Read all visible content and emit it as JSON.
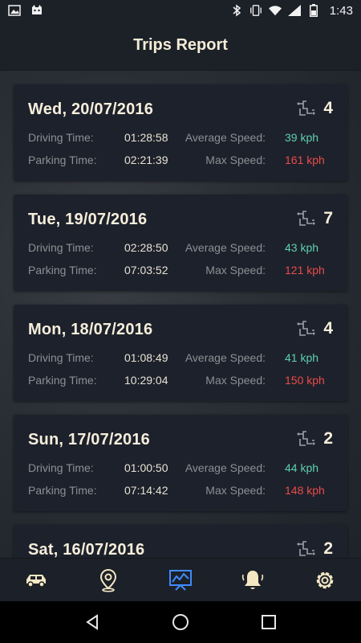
{
  "status_bar": {
    "time": "1:43"
  },
  "header": {
    "title": "Trips Report"
  },
  "labels": {
    "driving_time": "Driving Time:",
    "parking_time": "Parking Time:",
    "average_speed": "Average Speed:",
    "max_speed": "Max Speed:"
  },
  "reports": [
    {
      "date": "Wed, 20/07/2016",
      "trips": "4",
      "driving_time": "01:28:58",
      "parking_time": "02:21:39",
      "avg_speed": "39 kph",
      "max_speed": "161 kph"
    },
    {
      "date": "Tue, 19/07/2016",
      "trips": "7",
      "driving_time": "02:28:50",
      "parking_time": "07:03:52",
      "avg_speed": "43 kph",
      "max_speed": "121 kph"
    },
    {
      "date": "Mon, 18/07/2016",
      "trips": "4",
      "driving_time": "01:08:49",
      "parking_time": "10:29:04",
      "avg_speed": "41 kph",
      "max_speed": "150 kph"
    },
    {
      "date": "Sun, 17/07/2016",
      "trips": "2",
      "driving_time": "01:00:50",
      "parking_time": "07:14:42",
      "avg_speed": "44 kph",
      "max_speed": "148 kph"
    },
    {
      "date": "Sat, 16/07/2016",
      "trips": "2"
    }
  ],
  "bottom_nav": {
    "items": [
      {
        "icon": "car-icon"
      },
      {
        "icon": "location-pin-icon"
      },
      {
        "icon": "chart-icon",
        "active": true
      },
      {
        "icon": "bell-icon"
      },
      {
        "icon": "gear-icon"
      }
    ]
  },
  "colors": {
    "accent": "#3f8cff",
    "avg_speed": "#5fd1b2",
    "max_speed": "#ea4b4b",
    "icon_cream": "#f4e8c4"
  }
}
